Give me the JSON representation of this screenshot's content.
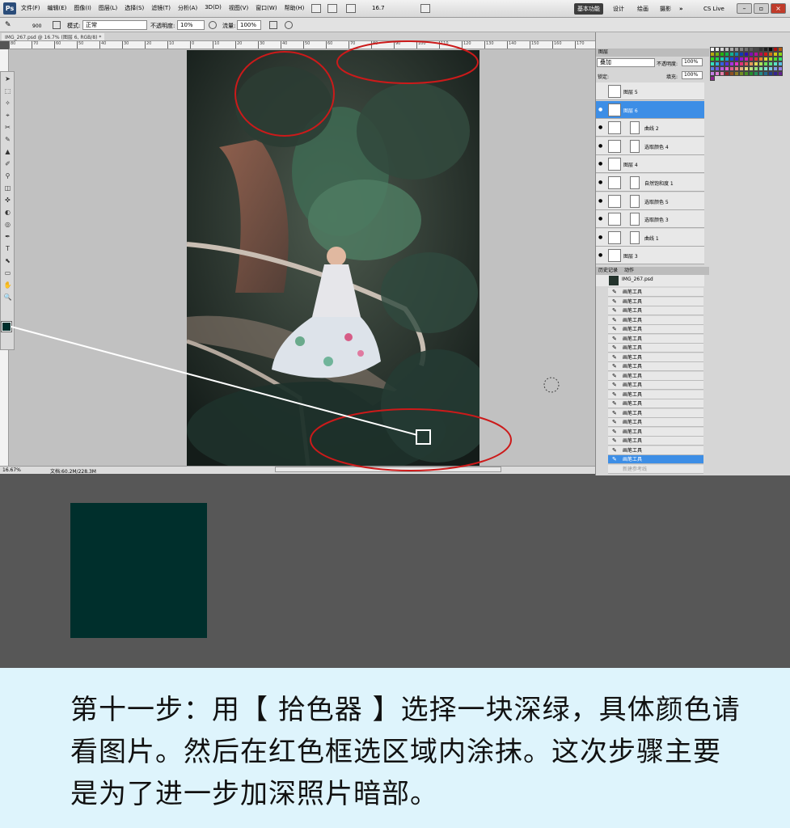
{
  "app": {
    "logo": "Ps"
  },
  "menus": [
    "文件(F)",
    "编辑(E)",
    "图像(I)",
    "图层(L)",
    "选择(S)",
    "滤镜(T)",
    "分析(A)",
    "3D(D)",
    "视图(V)",
    "窗口(W)",
    "帮助(H)"
  ],
  "toolbar": {
    "zoom": "16.7",
    "icons": [
      "bridge-icon",
      "minibridge-icon",
      "arrange-icon",
      "screen-mode-icon"
    ]
  },
  "workspaces": {
    "basic": "基本功能",
    "design": "设计",
    "draw": "绘画",
    "photo": "摄影",
    "more": "»",
    "cslive": "CS Live"
  },
  "options": {
    "brush_size": "900",
    "mode_label": "模式:",
    "mode_value": "正常",
    "opacity_label": "不透明度:",
    "opacity_value": "10%",
    "flow_label": "流量:",
    "flow_value": "100%"
  },
  "document": {
    "tab": "IMG_267.psd @ 16.7% (图层 6, RGB/8) *"
  },
  "ruler": {
    "ticks": [
      "80",
      "70",
      "60",
      "50",
      "40",
      "30",
      "20",
      "10",
      "0",
      "10",
      "20",
      "30",
      "40",
      "50",
      "60",
      "70",
      "80",
      "90",
      "100",
      "110",
      "120",
      "130",
      "140",
      "150",
      "160",
      "170"
    ]
  },
  "status": {
    "zoom": "16.67%",
    "doc": "文档:60.2M/228.3M"
  },
  "colors": {
    "foreground": "#002f2c",
    "accent": "#3d8ee6",
    "annotation": "#cc1a1a"
  },
  "panels": {
    "layers_tab": "图层",
    "blend_mode": "叠加",
    "opacity_label": "不透明度:",
    "opacity_value": "100%",
    "lock_label": "锁定:",
    "fill_label": "填充:",
    "fill_value": "100%",
    "layers": [
      {
        "name": "图层 5",
        "visible": false,
        "selected": false
      },
      {
        "name": "图层 6",
        "visible": true,
        "selected": true
      },
      {
        "name": "曲线 2",
        "visible": true,
        "selected": false
      },
      {
        "name": "选取颜色 4",
        "visible": true,
        "selected": false
      },
      {
        "name": "图层 4",
        "visible": true,
        "selected": false
      },
      {
        "name": "自然饱和度 1",
        "visible": true,
        "selected": false
      },
      {
        "name": "选取颜色 5",
        "visible": true,
        "selected": false
      },
      {
        "name": "选取颜色 3",
        "visible": true,
        "selected": false
      },
      {
        "name": "曲线 1",
        "visible": true,
        "selected": false
      },
      {
        "name": "图层 3",
        "visible": true,
        "selected": false
      }
    ],
    "history_tab": "历史记录",
    "actions_tab": "动作",
    "history_snapshot": "IMG_267.psd",
    "history_item": "画笔工具",
    "history_count": 19,
    "history_extra": "新建参考线"
  },
  "caption": "第十一步：用【 拾色器 】选择一块深绿，具体颜色请看图片。然后在红色框选区域内涂抹。这次步骤主要是为了进一步加深照片暗部。"
}
